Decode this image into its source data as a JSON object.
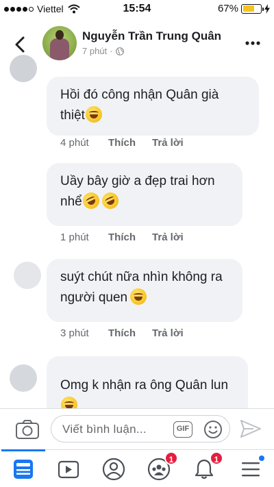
{
  "status_bar": {
    "carrier": "Viettel",
    "time": "15:54",
    "battery": "67%",
    "battery_level": 0.67
  },
  "header": {
    "name": "Nguyễn Trần Trung Quân",
    "time_ago": "7 phút",
    "separator": "·"
  },
  "comments": [
    {
      "lines": [
        "Hồi đó công nhận Quân già",
        "thiệt"
      ],
      "emojis": 1,
      "time": "4 phút",
      "like": "Thích",
      "reply": "Trả lời"
    },
    {
      "lines": [
        "Uầy bây giờ a đẹp trai hơn",
        "nhể"
      ],
      "emojis": 2,
      "time": "1 phút",
      "like": "Thích",
      "reply": "Trả lời"
    },
    {
      "lines": [
        "suýt chút nữa nhìn không ra",
        "người quen"
      ],
      "emojis": 1,
      "time": "3 phút",
      "like": "Thích",
      "reply": "Trả lời"
    },
    {
      "lines": [
        "Omg k nhận ra ông Quân lun",
        ""
      ],
      "emojis": 1
    }
  ],
  "composer": {
    "placeholder": "Viết bình luận...",
    "gif_label": "GIF"
  },
  "tabbar": {
    "groups_badge": "1",
    "notifications_badge": "1"
  },
  "icons": [
    "back-icon",
    "more-icon",
    "globe-icon",
    "camera-icon",
    "gif-icon",
    "emoji-icon",
    "send-icon",
    "feed-icon",
    "watch-icon",
    "profile-icon",
    "groups-icon",
    "bell-icon",
    "menu-icon"
  ],
  "colors": {
    "accent": "#1877f2",
    "badge": "#e41e3f",
    "bubble": "#f0f2f5",
    "battery": "#f3c521"
  }
}
